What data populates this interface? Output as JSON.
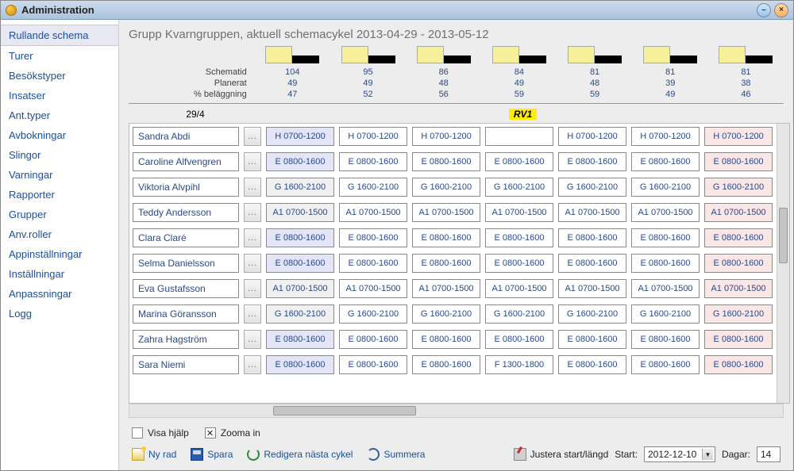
{
  "window": {
    "title": "Administration"
  },
  "sidebar": {
    "items": [
      {
        "label": "Rullande schema",
        "active": true
      },
      {
        "label": "Turer"
      },
      {
        "label": "Besökstyper"
      },
      {
        "label": "Insatser"
      },
      {
        "label": "Ant.typer"
      },
      {
        "label": "Avbokningar"
      },
      {
        "label": "Slingor"
      },
      {
        "label": "Varningar"
      },
      {
        "label": "Rapporter"
      },
      {
        "label": "Grupper"
      },
      {
        "label": "Anv.roller"
      },
      {
        "label": "Appinställningar"
      },
      {
        "label": "Inställningar"
      },
      {
        "label": "Anpassningar"
      },
      {
        "label": "Logg"
      }
    ]
  },
  "header": {
    "title": "Grupp Kvarngruppen, aktuell schemacykel 2013-04-29 - 2013-05-12"
  },
  "stats": {
    "labels": {
      "schematid": "Schematid",
      "planerat": "Planerat",
      "belagg": "% beläggning"
    },
    "cols": [
      {
        "schematid": "104",
        "planerat": "49",
        "belagg": "47"
      },
      {
        "schematid": "95",
        "planerat": "49",
        "belagg": "52"
      },
      {
        "schematid": "86",
        "planerat": "48",
        "belagg": "56"
      },
      {
        "schematid": "84",
        "planerat": "49",
        "belagg": "59"
      },
      {
        "schematid": "81",
        "planerat": "48",
        "belagg": "59"
      },
      {
        "schematid": "81",
        "planerat": "39",
        "belagg": "49"
      },
      {
        "schematid": "81",
        "planerat": "38",
        "belagg": "46"
      }
    ]
  },
  "dateheader": {
    "date": "29/4",
    "rv": "RV1"
  },
  "persons": [
    "Sandra Abdi",
    "Caroline Alfvengren",
    "Viktoria Alvpihl",
    "Teddy Andersson",
    "Clara Claré",
    "Selma Danielsson",
    "Eva Gustafsson",
    "Marina Göransson",
    "Zahra Hagström",
    "Sara Niemi"
  ],
  "schedule": [
    [
      "H 0700-1200",
      "H 0700-1200",
      "H 0700-1200",
      "",
      "H 0700-1200",
      "H 0700-1200",
      "H 0700-1200"
    ],
    [
      "E 0800-1600",
      "E 0800-1600",
      "E 0800-1600",
      "E 0800-1600",
      "E 0800-1600",
      "E 0800-1600",
      "E 0800-1600"
    ],
    [
      "G 1600-2100",
      "G 1600-2100",
      "G 1600-2100",
      "G 1600-2100",
      "G 1600-2100",
      "G 1600-2100",
      "G 1600-2100"
    ],
    [
      "A1 0700-1500",
      "A1 0700-1500",
      "A1 0700-1500",
      "A1 0700-1500",
      "A1 0700-1500",
      "A1 0700-1500",
      "A1 0700-1500"
    ],
    [
      "E 0800-1600",
      "E 0800-1600",
      "E 0800-1600",
      "E 0800-1600",
      "E 0800-1600",
      "E 0800-1600",
      "E 0800-1600"
    ],
    [
      "E 0800-1600",
      "E 0800-1600",
      "E 0800-1600",
      "E 0800-1600",
      "E 0800-1600",
      "E 0800-1600",
      "E 0800-1600"
    ],
    [
      "A1 0700-1500",
      "A1 0700-1500",
      "A1 0700-1500",
      "A1 0700-1500",
      "A1 0700-1500",
      "A1 0700-1500",
      "A1 0700-1500"
    ],
    [
      "G 1600-2100",
      "G 1600-2100",
      "G 1600-2100",
      "G 1600-2100",
      "G 1600-2100",
      "G 1600-2100",
      "G 1600-2100"
    ],
    [
      "E 0800-1600",
      "E 0800-1600",
      "E 0800-1600",
      "E 0800-1600",
      "E 0800-1600",
      "E 0800-1600",
      "E 0800-1600"
    ],
    [
      "E 0800-1600",
      "E 0800-1600",
      "E 0800-1600",
      "F 1300-1800",
      "E 0800-1600",
      "E 0800-1600",
      "E 0800-1600"
    ]
  ],
  "day_classes": [
    "monday",
    "normal",
    "normal",
    "normal",
    "normal",
    "normal",
    "sunday"
  ],
  "row_gray": [
    false,
    false,
    true,
    true,
    false,
    false,
    true,
    true,
    false,
    false
  ],
  "footer1": {
    "help": "Visa hjälp",
    "zoom": "Zooma in"
  },
  "footer2": {
    "newrow": "Ny rad",
    "save": "Spara",
    "editnext": "Redigera nästa cykel",
    "sum": "Summera",
    "adjust": "Justera start/längd",
    "start_label": "Start:",
    "start_value": "2012-12-10",
    "days_label": "Dagar:",
    "days_value": "14"
  }
}
